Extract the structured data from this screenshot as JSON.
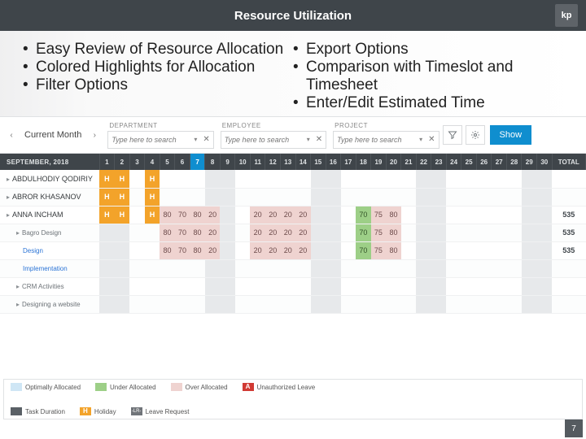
{
  "title": "Resource Utilization",
  "logo": "kp",
  "bullets_left": [
    "Easy Review of Resource Allocation",
    "Colored Highlights for Allocation",
    "Filter Options"
  ],
  "bullets_right": [
    "Export Options",
    "Comparison with Timeslot and Timesheet",
    "Enter/Edit Estimated Time"
  ],
  "filters": {
    "period": "Current Month",
    "dept_label": "DEPARTMENT",
    "emp_label": "EMPLOYEE",
    "proj_label": "PROJECT",
    "placeholder": "Type here to search",
    "show": "Show"
  },
  "month_header": "SEPTEMBER, 2018",
  "days": [
    "1",
    "2",
    "3",
    "4",
    "5",
    "6",
    "7",
    "8",
    "9",
    "10",
    "11",
    "12",
    "13",
    "14",
    "15",
    "16",
    "17",
    "18",
    "19",
    "20",
    "21",
    "22",
    "23",
    "24",
    "25",
    "26",
    "27",
    "28",
    "29",
    "30"
  ],
  "selected_day_index": 6,
  "weekend_cols": [
    0,
    1,
    7,
    8,
    14,
    15,
    21,
    22,
    28,
    29
  ],
  "total_label": "TOTAL",
  "rows": [
    {
      "type": "emp",
      "name": "ABDULHODIY QODIRIY",
      "cells": {
        "0": "H",
        "1": "H",
        "2": "",
        "3": "H"
      },
      "total": ""
    },
    {
      "type": "emp",
      "name": "ABROR KHASANOV",
      "cells": {
        "0": "H",
        "1": "H",
        "2": "",
        "3": "H"
      },
      "total": ""
    },
    {
      "type": "emp",
      "name": "ANNA INCHAM",
      "cells": {
        "0": "H",
        "1": "H",
        "2": "",
        "3": "H",
        "4": "80",
        "5": "70",
        "6": "80",
        "7": "20",
        "10": "20",
        "11": "20",
        "12": "20",
        "13": "20",
        "17": "70",
        "18": "75",
        "19": "80"
      },
      "total": "535"
    },
    {
      "type": "childTask",
      "name": "Bagro Design",
      "cells": {
        "4": "80",
        "5": "70",
        "6": "80",
        "7": "20",
        "10": "20",
        "11": "20",
        "12": "20",
        "13": "20",
        "17": "70",
        "18": "75",
        "19": "80"
      },
      "total": "535"
    },
    {
      "type": "subsubTask",
      "name": "Design",
      "cells": {
        "4": "80",
        "5": "70",
        "6": "80",
        "7": "20",
        "10": "20",
        "11": "20",
        "12": "20",
        "13": "20",
        "17": "70",
        "18": "75",
        "19": "80"
      },
      "total": "535"
    },
    {
      "type": "subsubTask",
      "name": "Implementation",
      "cells": {},
      "total": ""
    },
    {
      "type": "childTask",
      "name": "CRM Activities",
      "cells": {},
      "total": ""
    },
    {
      "type": "childTask",
      "name": "Designing a website",
      "cells": {},
      "total": ""
    }
  ],
  "legend": {
    "opt": "Optimally Allocated",
    "under": "Under Allocated",
    "over": "Over Allocated",
    "auth": "Unauthorized Leave",
    "task": "Task Duration",
    "holi": "Holiday",
    "lreq": "Leave Request",
    "auth_badge": "A",
    "lreq_badge": "-LR-"
  },
  "page_number": "7"
}
